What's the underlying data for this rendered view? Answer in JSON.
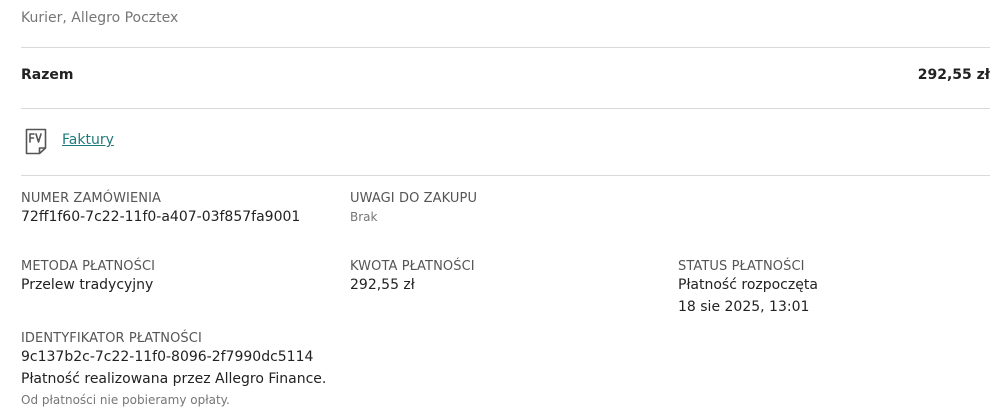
{
  "shipping": {
    "method": "Kurier, Allegro Pocztex"
  },
  "summary": {
    "total_label": "Razem",
    "total_value": "292,55 zł"
  },
  "invoices": {
    "icon": "invoice-document-icon",
    "link_label": "Faktury"
  },
  "order_details": {
    "order_number_label": "NUMER ZAMÓWIENIA",
    "order_number_value": "72ff1f60-7c22-11f0-a407-03f857fa9001",
    "notes_label": "UWAGI DO ZAKUPU",
    "notes_value": "Brak",
    "payment_method_label": "METODA PŁATNOŚCI",
    "payment_method_value": "Przelew tradycyjny",
    "payment_amount_label": "KWOTA PŁATNOŚCI",
    "payment_amount_value": "292,55 zł",
    "payment_status_label": "STATUS PŁATNOŚCI",
    "payment_status_value": "Płatność rozpoczęta",
    "payment_status_date": "18 sie 2025, 13:01",
    "payment_id_label": "IDENTYFIKATOR PŁATNOŚCI",
    "payment_id_value": "9c137b2c-7c22-11f0-8096-2f7990dc5114",
    "payment_provider_note": "Płatność realizowana przez Allegro Finance.",
    "fee_note": "Od płatności nie pobieramy opłaty."
  },
  "colors": {
    "link": "#1f7a7a",
    "divider": "#d9d9d9",
    "muted_text": "#767676"
  }
}
